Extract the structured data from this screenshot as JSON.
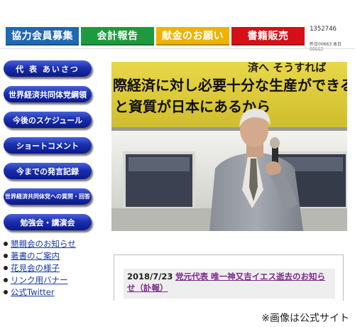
{
  "topnav": {
    "items": [
      {
        "label": "協力会員募集",
        "color": "#1f68b3"
      },
      {
        "label": "会計報告",
        "color": "#1d9a3e"
      },
      {
        "label": "献金のお願い",
        "color": "#f0b200"
      },
      {
        "label": "書籍販売",
        "color": "#d51018"
      }
    ],
    "counter": "1352746",
    "counter_sub": "昨日00663 本日00663"
  },
  "sidemenu": {
    "items": [
      {
        "label": "代 表 あいさつ"
      },
      {
        "label": "世界経済共同体党綱領"
      },
      {
        "label": "今後のスケジュール"
      },
      {
        "label": "ショートコメント"
      },
      {
        "label": "今までの発言記録"
      },
      {
        "label": "世界経済共同体党への質問・回答"
      },
      {
        "label": "勉強会・講演会"
      }
    ]
  },
  "links": {
    "items": [
      {
        "label": "懇親会のお知らせ"
      },
      {
        "label": "著書のご案内"
      },
      {
        "label": "花見会の様子"
      },
      {
        "label": "リンク用バナー"
      },
      {
        "label": "公式Twitter"
      }
    ]
  },
  "photo": {
    "banner_line1": "際経済に対し必要十分な生産ができる",
    "banner_line2": "と資質が日本にあるから",
    "banner_top": "済へ そうすれば"
  },
  "news": {
    "date": "2018/7/23",
    "headline": "党元代表 唯一神又吉イエス逝去のお知らせ（訃報）"
  },
  "caption": "※画像は公式サイト"
}
